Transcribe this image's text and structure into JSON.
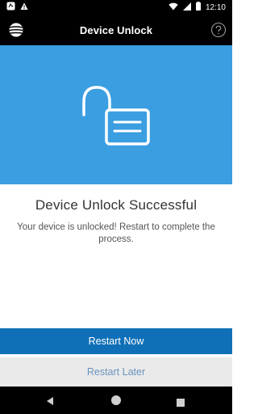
{
  "status_bar": {
    "time": "12:10",
    "icons": [
      "notification-icon",
      "alert-icon",
      "wifi-icon",
      "signal-icon",
      "battery-icon"
    ]
  },
  "app_bar": {
    "title": "Device Unlock",
    "logo_icon": "att-globe-icon",
    "help_icon": "help-icon"
  },
  "hero": {
    "icon": "unlocked-padlock-icon"
  },
  "content": {
    "headline": "Device Unlock Successful",
    "message": "Your device is unlocked! Restart to complete the process."
  },
  "actions": {
    "primary_label": "Restart Now",
    "secondary_label": "Restart Later"
  },
  "nav": {
    "back_icon": "back-icon",
    "home_icon": "home-icon",
    "recent_icon": "recents-icon"
  },
  "colors": {
    "hero": "#3a9ee1",
    "primary_button": "#0f70b7",
    "secondary_button": "#eaeaea",
    "secondary_text": "#6a93bf",
    "bars": "#000000"
  }
}
